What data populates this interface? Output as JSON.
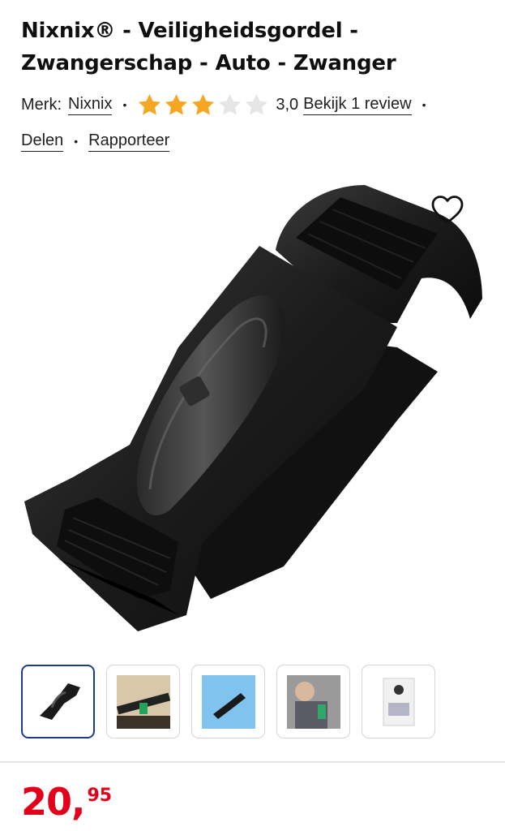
{
  "product": {
    "title_line1": "Nixnix® - Veiligheidsgordel -",
    "title_line2": "Zwangerschap - Auto - Zwanger"
  },
  "meta": {
    "brand_label": "Merk:",
    "brand_name": "Nixnix",
    "rating_value": "3,0",
    "rating_stars_filled": 3,
    "rating_stars_total": 5,
    "review_link": "Bekijk 1 review",
    "share_link": "Delen",
    "report_link": "Rapporteer"
  },
  "colors": {
    "star_filled": "#f5a623",
    "star_empty": "#e6e6e6",
    "price": "#e3001b",
    "active_thumb_border": "#1e3a8a"
  },
  "icons": {
    "favorite": "heart-outline-icon"
  },
  "gallery": {
    "thumbnails": [
      "belt-clip-black",
      "belt-in-car-seat",
      "belt-clip-blue-bg",
      "pregnant-woman-in-car",
      "product-packaging"
    ],
    "active_index": 0
  },
  "price": {
    "whole": "20",
    "separator": ",",
    "cents": "95"
  }
}
